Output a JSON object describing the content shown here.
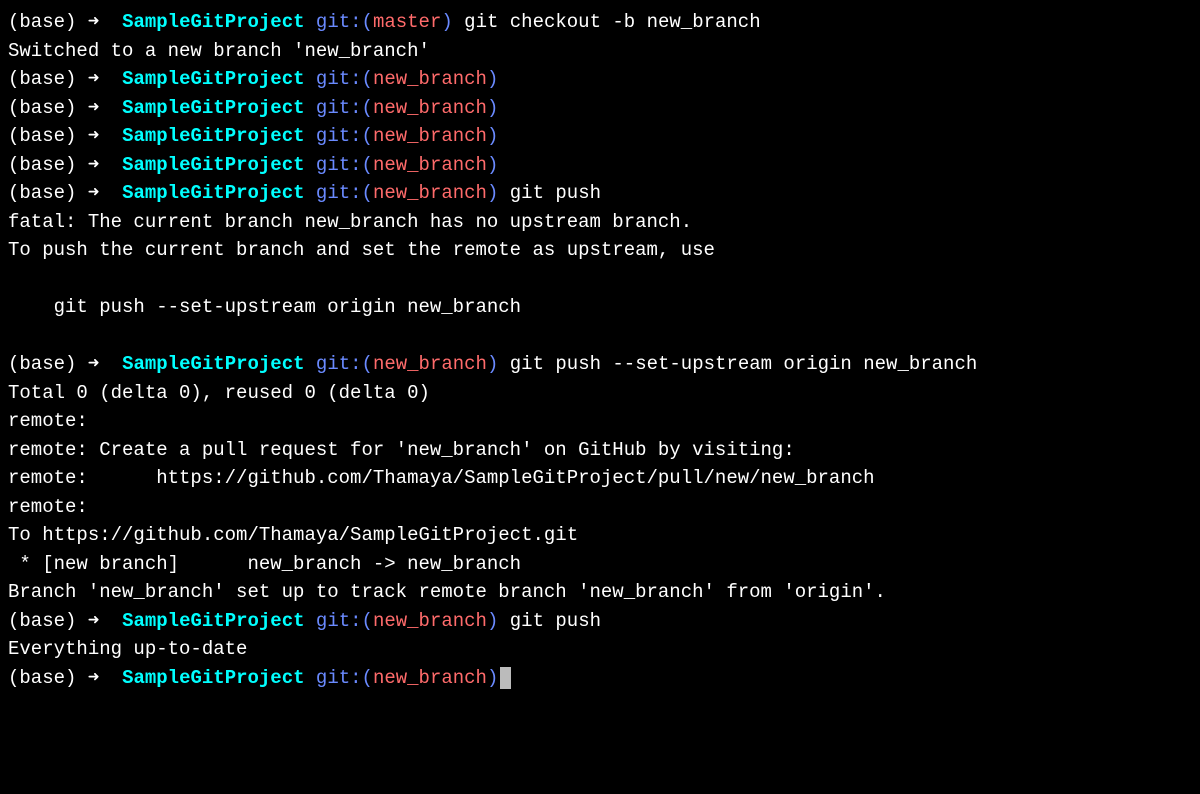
{
  "prompt": {
    "base": "(base)",
    "arrow": " ➜  ",
    "project": "SampleGitProject",
    "git_label": " git:(",
    "paren_close": ")",
    "branch_master": "master",
    "branch_new": "new_branch"
  },
  "commands": {
    "checkout": " git checkout -b new_branch",
    "push": " git push",
    "push_upstream": " git push --set-upstream origin new_branch"
  },
  "output": {
    "switched": "Switched to a new branch 'new_branch'",
    "fatal": "fatal: The current branch new_branch has no upstream branch.",
    "to_push": "To push the current branch and set the remote as upstream, use",
    "blank": "",
    "suggest": "    git push --set-upstream origin new_branch",
    "total": "Total 0 (delta 0), reused 0 (delta 0)",
    "remote1": "remote: ",
    "remote2": "remote: Create a pull request for 'new_branch' on GitHub by visiting:",
    "remote3": "remote:      https://github.com/Thamaya/SampleGitProject/pull/new/new_branch",
    "remote4": "remote: ",
    "to_url": "To https://github.com/Thamaya/SampleGitProject.git",
    "new_branch_line": " * [new branch]      new_branch -> new_branch",
    "tracking": "Branch 'new_branch' set up to track remote branch 'new_branch' from 'origin'.",
    "uptodate": "Everything up-to-date"
  }
}
